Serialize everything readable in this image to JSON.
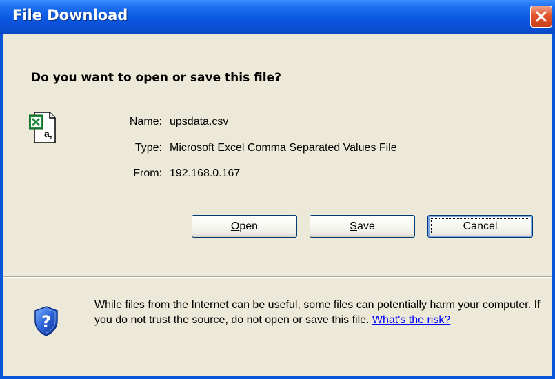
{
  "window": {
    "title": "File Download"
  },
  "dialog": {
    "question": "Do you want to open or save this file?",
    "file": {
      "icon": "excel-csv-file-icon",
      "name_label": "Name:",
      "name_value": "upsdata.csv",
      "type_label": "Type:",
      "type_value": "Microsoft Excel Comma Separated Values File",
      "from_label": "From:",
      "from_value": "192.168.0.167"
    },
    "buttons": {
      "open": {
        "mnemonic": "O",
        "rest": "pen"
      },
      "save": {
        "mnemonic": "S",
        "rest": "ave"
      },
      "cancel": "Cancel"
    },
    "warning": {
      "icon": "security-shield-question-icon",
      "text": "While files from the Internet can be useful, some files can potentially harm your computer. If you do not trust the source, do not open or save this file. ",
      "link": "What's the risk?"
    }
  },
  "colors": {
    "titlebar": "#0A58E0",
    "dialog_bg": "#ECE9D8",
    "close_button": "#E2542E",
    "button_border": "#003C74",
    "link": "#0000FF"
  }
}
